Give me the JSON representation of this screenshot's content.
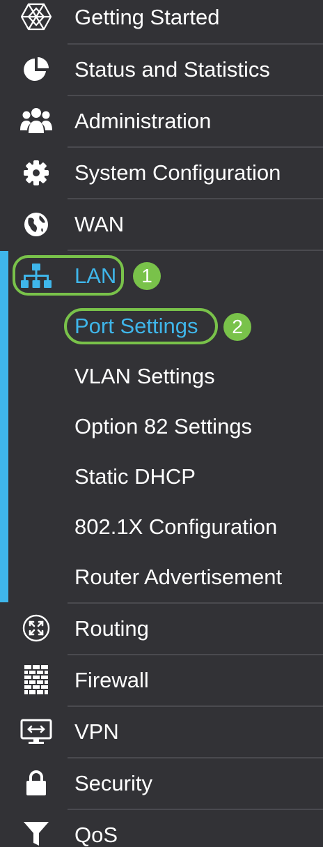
{
  "menu": {
    "getting_started": "Getting Started",
    "status_statistics": "Status and Statistics",
    "administration": "Administration",
    "system_configuration": "System Configuration",
    "wan": "WAN",
    "lan": "LAN",
    "routing": "Routing",
    "firewall": "Firewall",
    "vpn": "VPN",
    "security": "Security",
    "qos": "QoS"
  },
  "lan_submenu": {
    "port_settings": "Port Settings",
    "vlan_settings": "VLAN Settings",
    "option82_settings": "Option 82 Settings",
    "static_dhcp": "Static DHCP",
    "dot1x_configuration": "802.1X Configuration",
    "router_advertisement": "Router Advertisement"
  },
  "callouts": {
    "step1": "1",
    "step2": "2"
  },
  "colors": {
    "background": "#323236",
    "accent": "#3fb6ea",
    "callout": "#79c24a"
  }
}
